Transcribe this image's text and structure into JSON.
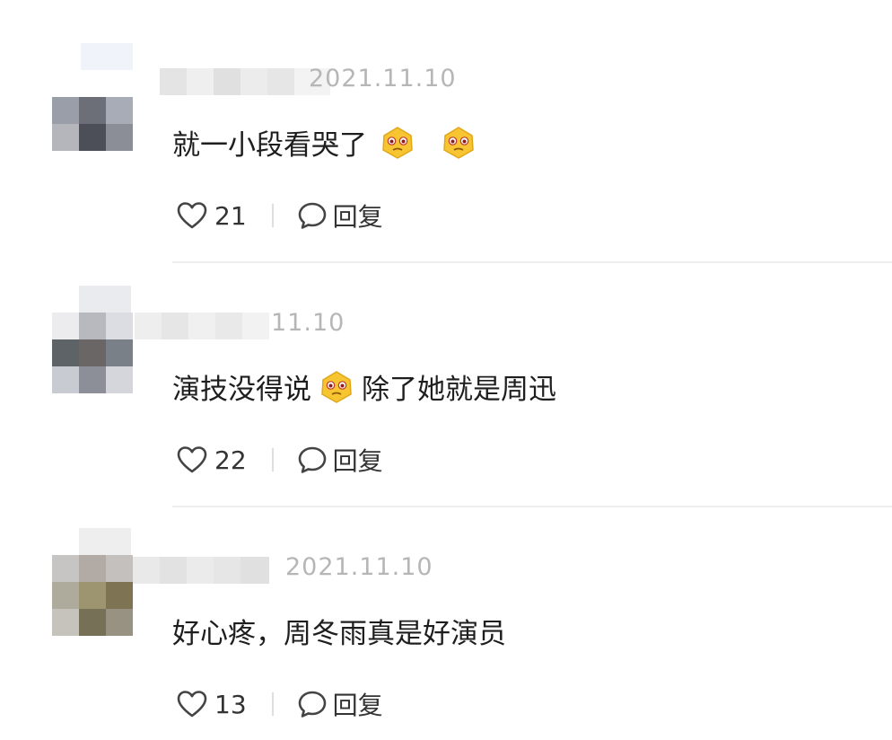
{
  "comments": [
    {
      "date": "2021.11.10",
      "text_before": "就一小段看哭了",
      "text_after": "",
      "likes": "21",
      "reply_label": "回复",
      "emojis_after_text": 2
    },
    {
      "date": "11.10",
      "text_before": "演技没得说",
      "text_after": "除了她就是周迅",
      "likes": "22",
      "reply_label": "回复",
      "emojis_after_text": 1
    },
    {
      "date": "2021.11.10",
      "text_before": "好心疼，周冬雨真是好演员",
      "text_after": "",
      "likes": "13",
      "reply_label": "回复",
      "emojis_after_text": 0
    }
  ],
  "icons": {
    "like": "heart-outline-icon",
    "reply": "speech-bubble-icon",
    "emoji": "teary-face-emoji"
  },
  "colors": {
    "date": "#b6b6b6",
    "text": "#1e1e1e",
    "divider": "#eeeeee",
    "emoji_yellow": "#f7c531"
  }
}
